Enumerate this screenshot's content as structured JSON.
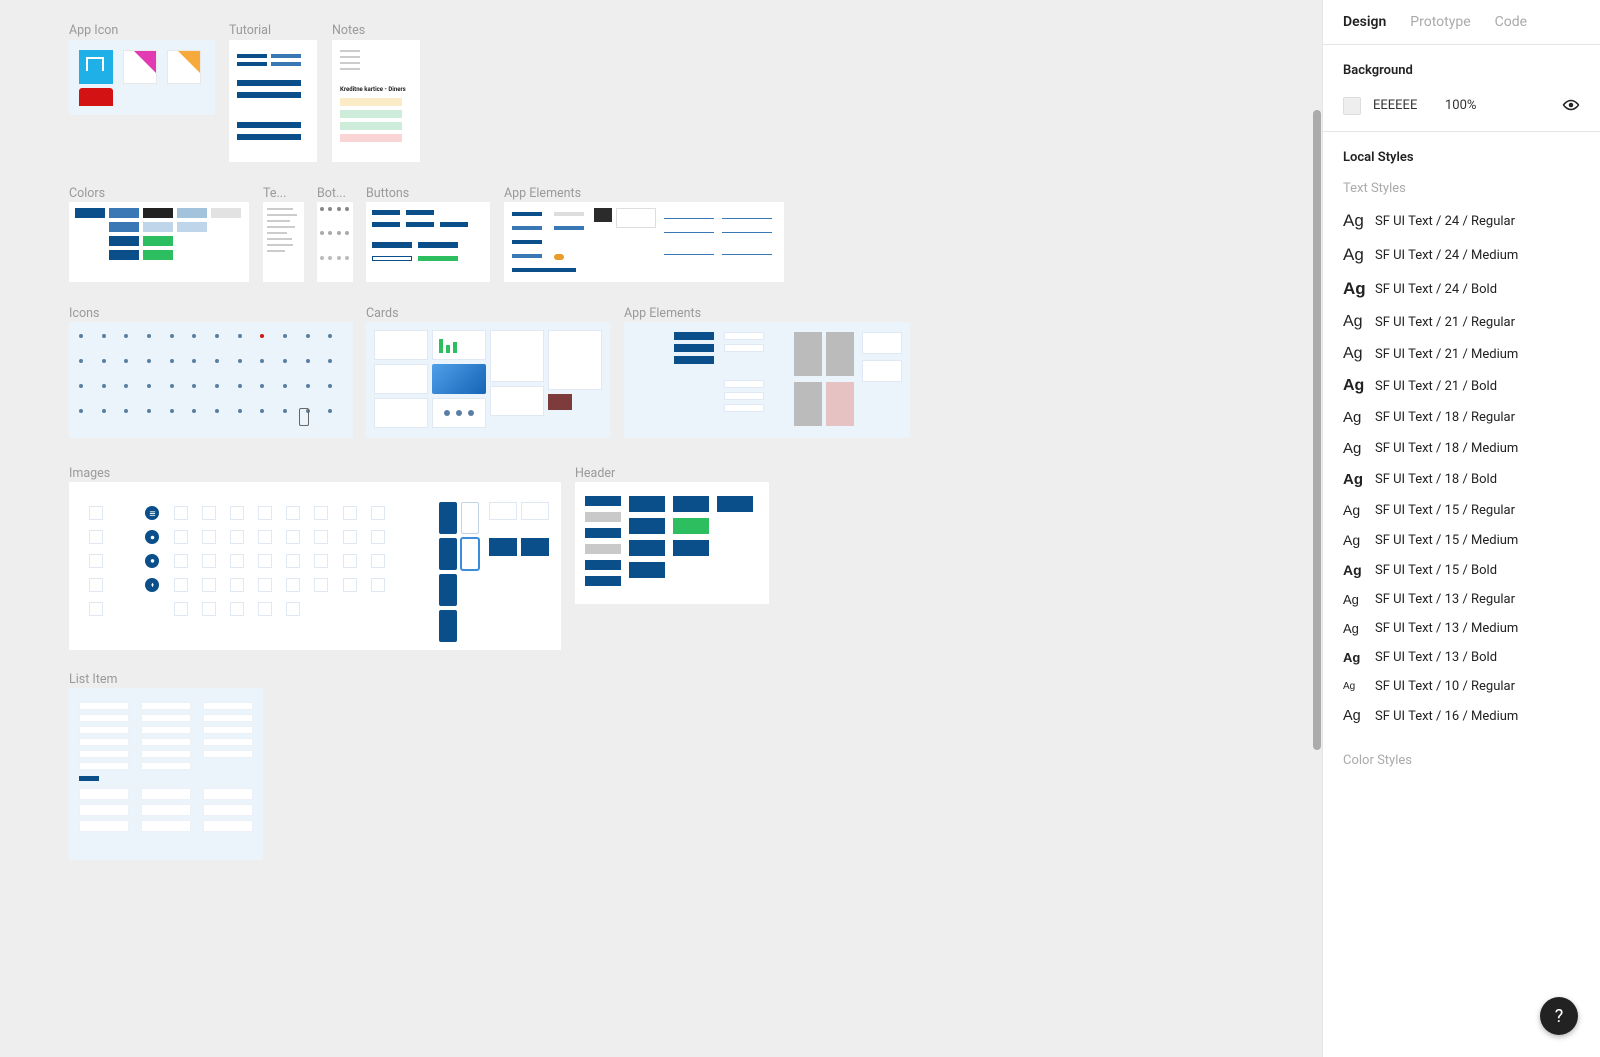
{
  "tabs": {
    "design": "Design",
    "prototype": "Prototype",
    "code": "Code"
  },
  "background": {
    "title": "Background",
    "hex": "EEEEEE",
    "opacity": "100%"
  },
  "local_styles": {
    "title": "Local Styles",
    "text_styles_title": "Text Styles",
    "color_styles_title": "Color Styles"
  },
  "text_styles": [
    {
      "label": "SF UI Text / 24 / Regular",
      "size": "s24",
      "weight": "reg"
    },
    {
      "label": "SF UI Text / 24 / Medium",
      "size": "s24",
      "weight": "med"
    },
    {
      "label": "SF UI Text / 24 / Bold",
      "size": "s24",
      "weight": "bold"
    },
    {
      "label": "SF UI Text / 21 / Regular",
      "size": "s21",
      "weight": "reg"
    },
    {
      "label": "SF UI Text / 21 / Medium",
      "size": "s21",
      "weight": "med"
    },
    {
      "label": "SF UI Text / 21 / Bold",
      "size": "s21",
      "weight": "bold"
    },
    {
      "label": "SF UI Text / 18 / Regular",
      "size": "s18",
      "weight": "reg"
    },
    {
      "label": "SF UI Text / 18 / Medium",
      "size": "s18",
      "weight": "med"
    },
    {
      "label": "SF UI Text / 18 / Bold",
      "size": "s18",
      "weight": "bold"
    },
    {
      "label": "SF UI Text / 15 / Regular",
      "size": "s15",
      "weight": "reg"
    },
    {
      "label": "SF UI Text / 15 / Medium",
      "size": "s15",
      "weight": "med"
    },
    {
      "label": "SF UI Text / 15 / Bold",
      "size": "s15",
      "weight": "bold"
    },
    {
      "label": "SF UI Text / 13 / Regular",
      "size": "s13",
      "weight": "reg"
    },
    {
      "label": "SF UI Text / 13 / Medium",
      "size": "s13",
      "weight": "med"
    },
    {
      "label": "SF UI Text / 13 / Bold",
      "size": "s13",
      "weight": "bold"
    },
    {
      "label": "SF UI Text / 10 / Regular",
      "size": "s10",
      "weight": "reg"
    },
    {
      "label": "SF UI Text / 16 / Medium",
      "size": "s16",
      "weight": "med"
    }
  ],
  "help": "?",
  "ag_sample": "Ag",
  "frames": {
    "app_icon": "App Icon",
    "tutorial": "Tutorial",
    "notes": "Notes",
    "notes_heading": "Kreditne kartice - Diners",
    "colors": "Colors",
    "te": "Te...",
    "bot": "Bot...",
    "buttons": "Buttons",
    "app_el1": "App Elements",
    "icons": "Icons",
    "cards": "Cards",
    "app_el2": "App Elements",
    "images": "Images",
    "header": "Header",
    "list_item": "List Item"
  }
}
